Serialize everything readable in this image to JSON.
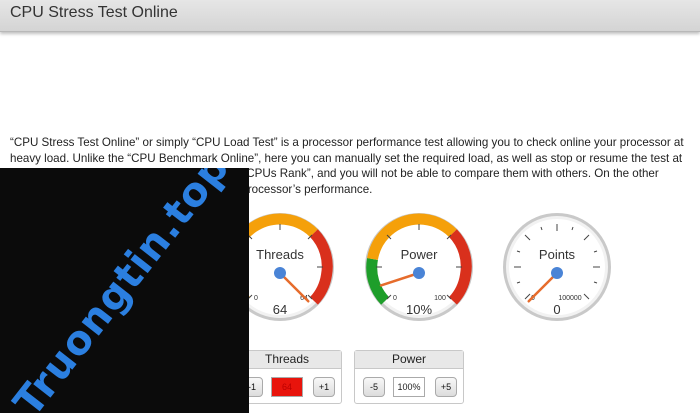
{
  "header": {
    "title": "CPU Stress Test Online"
  },
  "intro": {
    "text": "“CPU Stress Test Online” or simply “CPU Load Test” is a processor performance test allowing you to check online your processor at heavy load. Unlike the “CPU Benchmark Online”, here you can manually set the required load, as well as stop or resume the test at any time. The results will not be stored in the “CPUs Rank”, and you will not be able to compare them with others. On the other hand, here you can find out the limits of your processor’s performance."
  },
  "gauges": [
    {
      "label": "Threads",
      "min": "0",
      "max": "64",
      "value": "64",
      "level": 1.0
    },
    {
      "label": "Power",
      "min": "0",
      "max": "100",
      "value": "10%",
      "level": 0.1
    },
    {
      "label": "Points",
      "min": "0",
      "max": "100000",
      "value": "0",
      "level": 0.0
    }
  ],
  "controls": {
    "threads": {
      "title": "Threads",
      "minus": "-1",
      "value": "64",
      "plus": "+1"
    },
    "power": {
      "title": "Power",
      "minus": "-5",
      "value": "100%",
      "plus": "+5"
    }
  },
  "watermark": {
    "text": "Truongtin.top"
  },
  "colors": {
    "orange": "#f5a00a",
    "red": "#d9301c",
    "green": "#1e9e2a",
    "needle": "#e66c2c",
    "hub": "#4a84d6",
    "threads_value_bg": "#e8140c"
  }
}
